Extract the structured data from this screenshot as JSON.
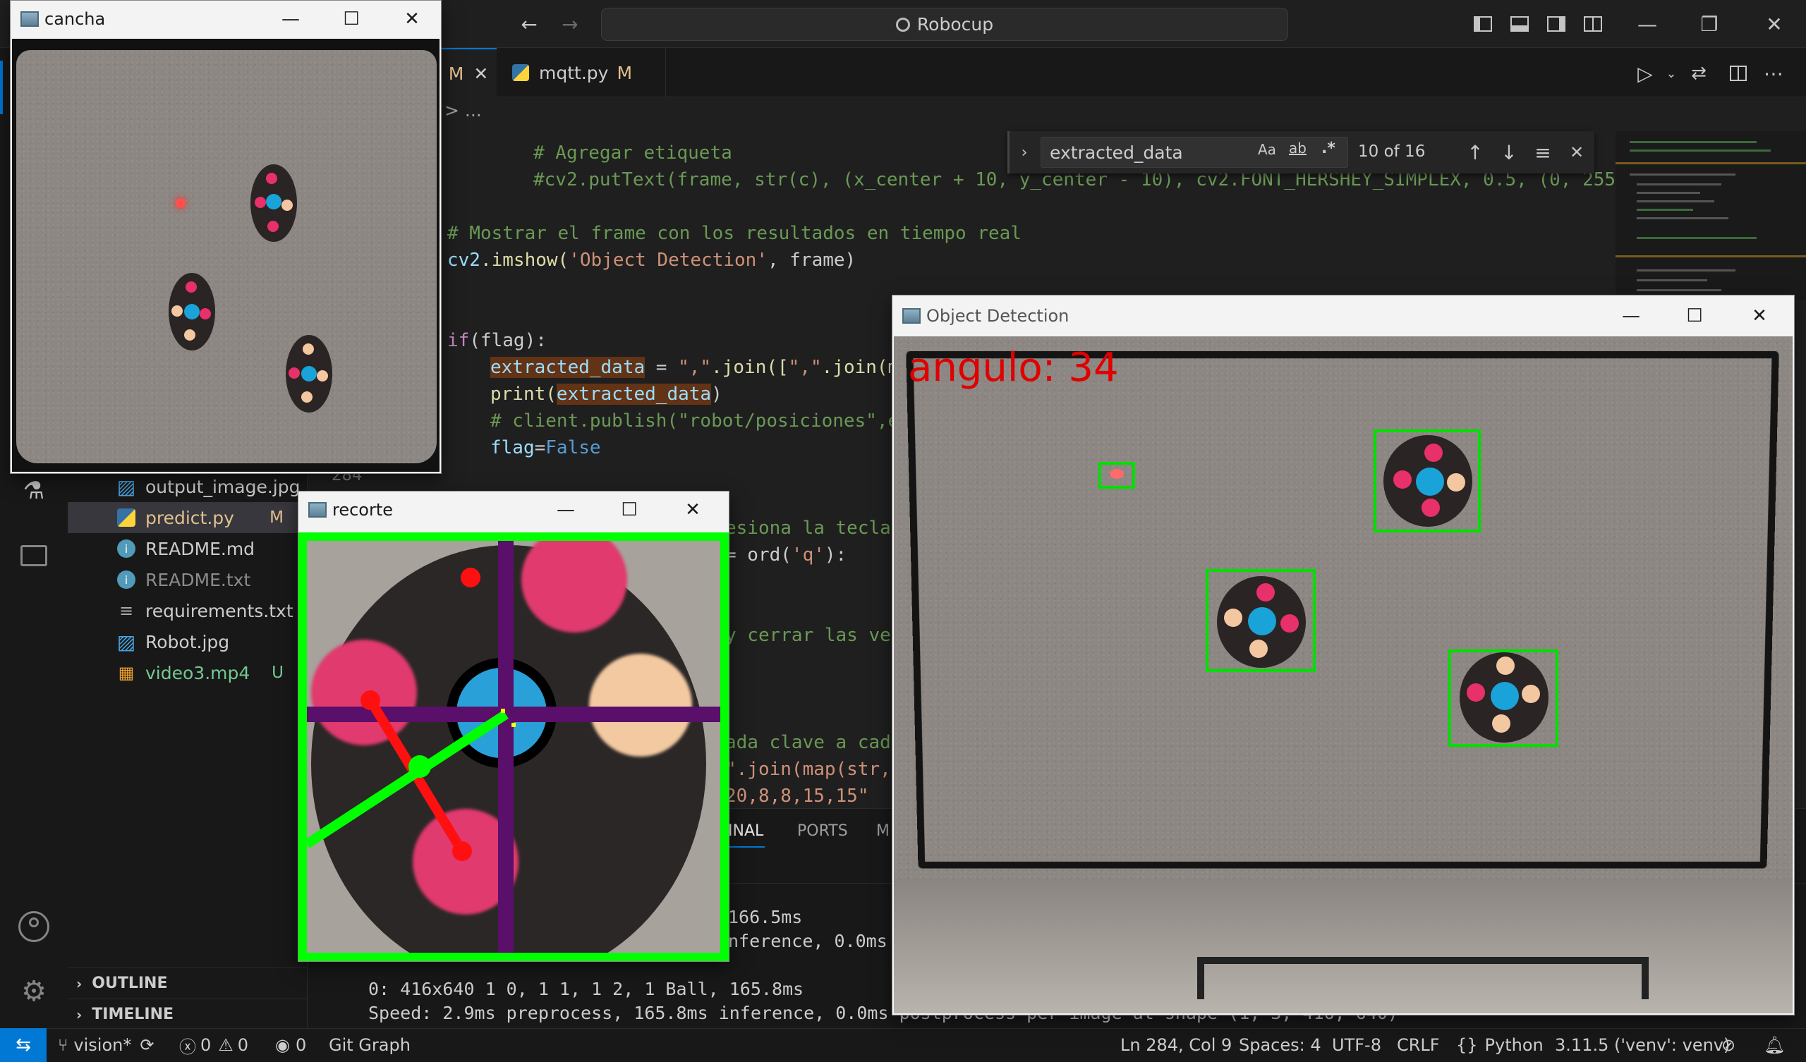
{
  "titlebar": {
    "search_text": "Robocup"
  },
  "tabs": [
    {
      "label": "M",
      "status": "M"
    },
    {
      "label": "mqtt.py",
      "status": "M"
    }
  ],
  "breadcrumbs": "> ...",
  "find": {
    "query": "extracted_data",
    "match_case": "Aa",
    "whole_word": "ab",
    "regex": ".*",
    "count": "10 of 16"
  },
  "code": {
    "l1": "# Agregar etiqueta",
    "l2": "#cv2.putText(frame, str(c), (x_center + 10, y_center - 10), cv2.FONT_HERSHEY_SIMPLEX, 0.5, (0, 255,",
    "l3": "# Mostrar el frame con los resultados en tiempo real",
    "l4a": "cv2",
    "l4b": ".imshow(",
    "l4c": "'Object Detection'",
    "l4d": ", frame)",
    "l5a": "if",
    "l5b": "(flag):",
    "l6a": "extracted_data",
    "l6b": " = ",
    "l6c": "\",\"",
    "l6d": ".join([",
    "l6e": "\",\"",
    "l6f": ".join(m",
    "l7a": "print(",
    "l7b": "extracted_data",
    "l7c": ")",
    "l8": "# client.publish(\"robot/posiciones\",e",
    "l9a": "flag",
    "l9b": "=",
    "l9c": "False",
    "l10": "esiona la tecla",
    "l11a": "= ord(",
    "l11b": "'q'",
    "l11c": "):",
    "l12": "y cerrar las ve",
    "l13": "ada clave a cad",
    "l14": "\".join(map(str,",
    "l15": "20,8,8,15,15\"",
    "line_no": "284"
  },
  "explorer": {
    "files": [
      {
        "name": "output_image.jpg",
        "status": "",
        "icon": "image-icon"
      },
      {
        "name": "predict.py",
        "status": "M",
        "icon": "python-icon"
      },
      {
        "name": "README.md",
        "status": "",
        "icon": "info-icon"
      },
      {
        "name": "README.txt",
        "status": "",
        "icon": "info-icon"
      },
      {
        "name": "requirements.txt",
        "status": "",
        "icon": "lines-icon"
      },
      {
        "name": "Robot.jpg",
        "status": "",
        "icon": "image-icon"
      },
      {
        "name": "video3.mp4",
        "status": "U",
        "icon": "video-icon"
      }
    ],
    "outline": "OUTLINE",
    "timeline": "TIMELINE"
  },
  "panel": {
    "tabs": [
      "INAL",
      "PORTS",
      "M"
    ],
    "lines": [
      "166.5ms",
      "nference, 0.0ms",
      "0: 416x640 1 0, 1 1, 1 2, 1 Ball, 165.8ms",
      "Speed: 2.9ms preprocess, 165.8ms inference, 0.0ms postprocess per image at shape (1, 3, 416, 640)"
    ]
  },
  "status": {
    "branch": "vision*",
    "errors": "0",
    "warnings": "0",
    "ports": "0",
    "git_graph": "Git Graph",
    "position": "Ln 284, Col 9",
    "spaces": "Spaces: 4",
    "encoding": "UTF-8",
    "eol": "CRLF",
    "language": "Python",
    "interpreter": "3.11.5 ('venv': venv)"
  },
  "windows": {
    "cancha": {
      "title": "cancha"
    },
    "recorte": {
      "title": "recorte"
    },
    "detection": {
      "title": "Object Detection",
      "overlay": "angulo: 34"
    }
  },
  "colors": {
    "accent": "#0078d4",
    "detection_box": "#00e000",
    "overlay_text": "#e00000"
  }
}
